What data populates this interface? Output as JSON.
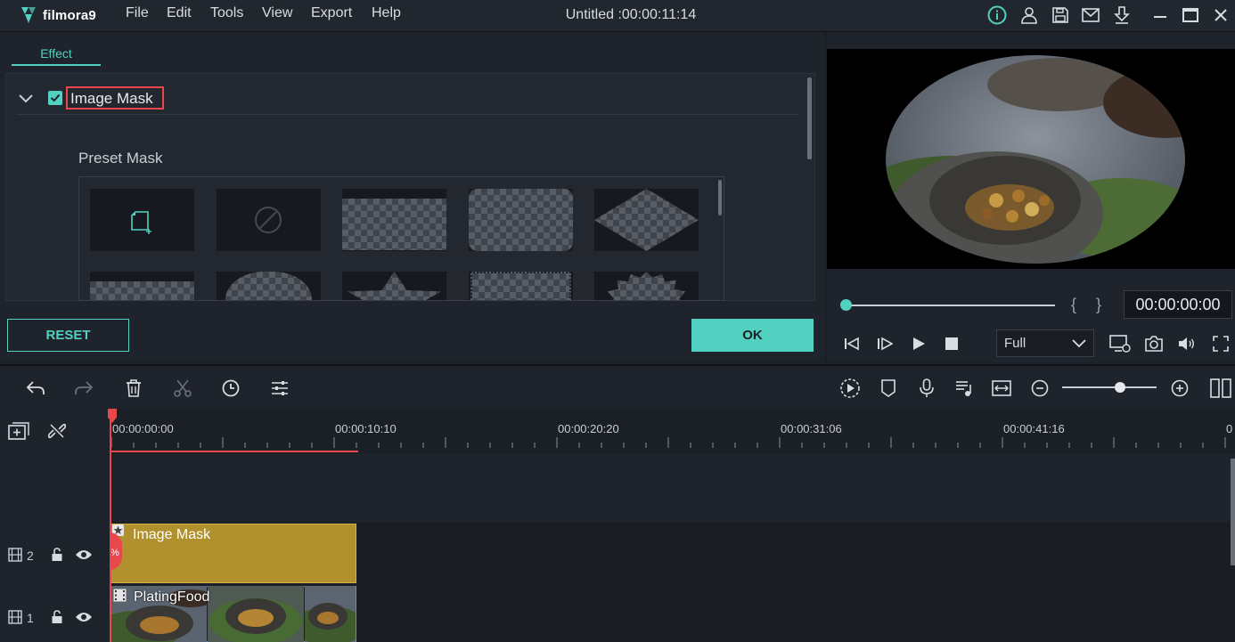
{
  "app": {
    "brand": "filmora9",
    "menu": [
      "File",
      "Edit",
      "Tools",
      "View",
      "Export",
      "Help"
    ],
    "document_title": "Untitled :00:00:11:14"
  },
  "effect_panel": {
    "tab_label": "Effect",
    "section_title": "Image Mask",
    "section_enabled": true,
    "preset_label": "Preset Mask",
    "reset_label": "RESET",
    "ok_label": "OK"
  },
  "preview": {
    "timecode": "00:00:00:00",
    "brace_left": "{",
    "brace_right": "}",
    "quality": "Full"
  },
  "timeline": {
    "ruler_labels": [
      "00:00:00:00",
      "00:00:10:10",
      "00:00:20:20",
      "00:00:31:06",
      "00:00:41:16",
      "0"
    ],
    "tracks": [
      {
        "number": "2",
        "clip_label": "Image Mask"
      },
      {
        "number": "1",
        "clip_label": "PlatingFood"
      }
    ]
  },
  "colors": {
    "accent": "#52d1c1",
    "highlight": "#e8474b",
    "mask_clip": "#b0912e",
    "video_clip_border": "#6b88c7"
  }
}
